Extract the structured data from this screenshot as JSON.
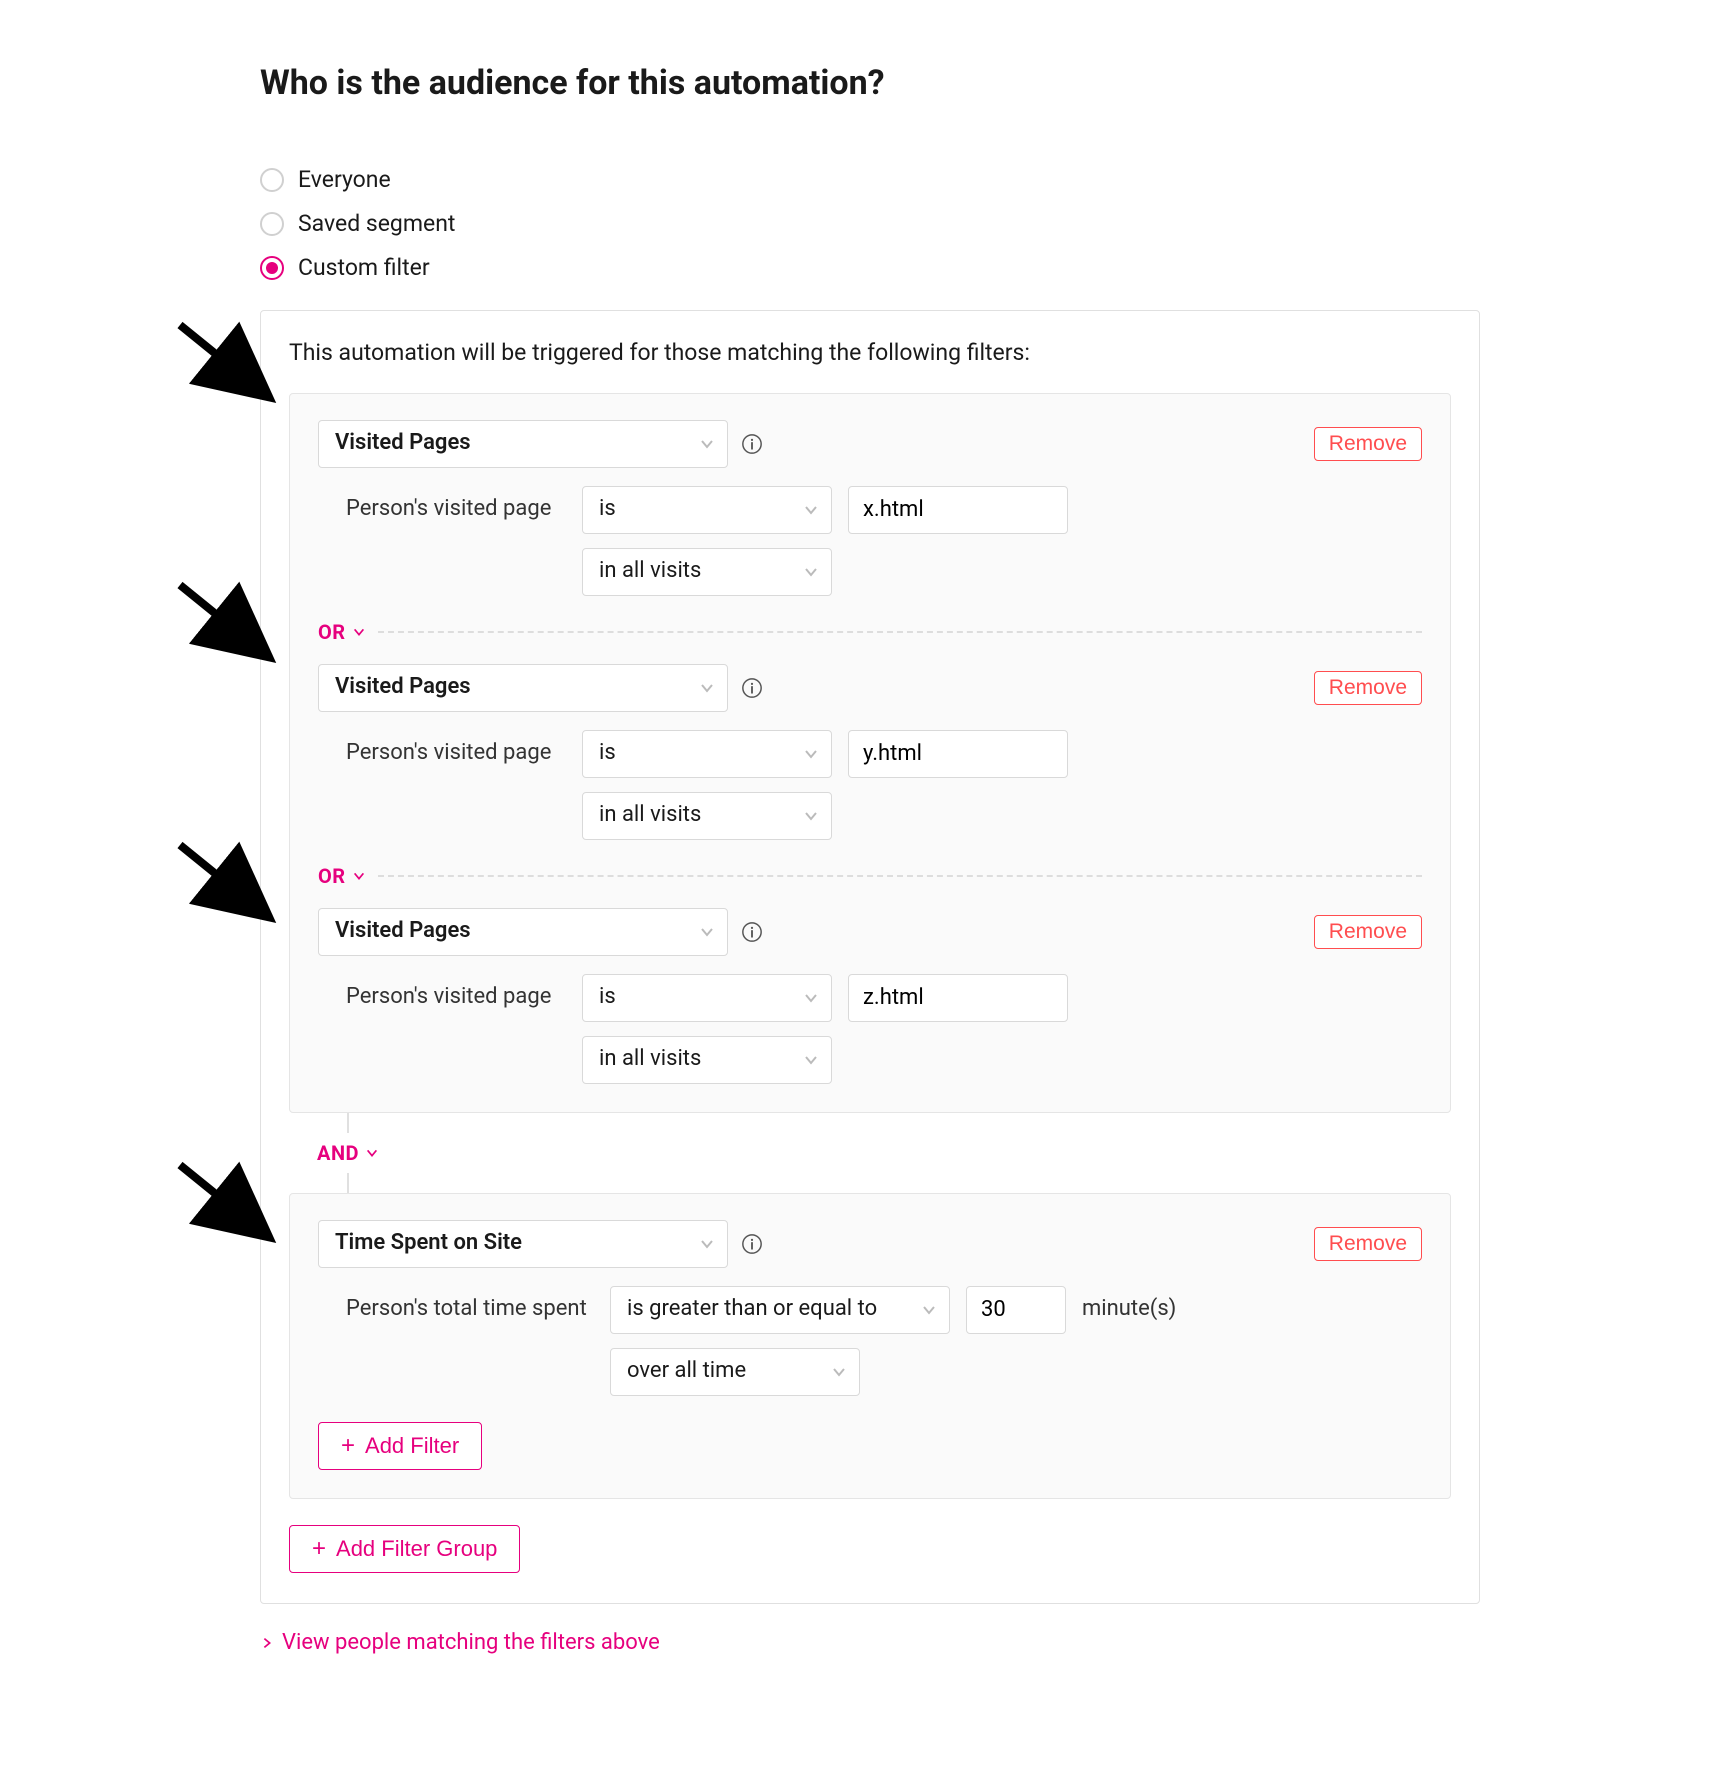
{
  "title": "Who is the audience for this automation?",
  "radios": {
    "everyone": "Everyone",
    "saved_segment": "Saved segment",
    "custom_filter": "Custom filter",
    "selected": "custom_filter"
  },
  "panel": {
    "intro": "This automation will be triggered for those matching the following filters:",
    "remove_label": "Remove",
    "or_label": "OR",
    "and_label": "AND",
    "add_filter_label": "Add Filter",
    "add_group_label": "Add Filter Group",
    "view_link": "View people matching the filters above"
  },
  "group1": {
    "filters": [
      {
        "type": "Visited Pages",
        "cond_label": "Person's visited page",
        "operator": "is",
        "value": "x.html",
        "scope": "in all visits"
      },
      {
        "type": "Visited Pages",
        "cond_label": "Person's visited page",
        "operator": "is",
        "value": "y.html",
        "scope": "in all visits"
      },
      {
        "type": "Visited Pages",
        "cond_label": "Person's visited page",
        "operator": "is",
        "value": "z.html",
        "scope": "in all visits"
      }
    ]
  },
  "group2": {
    "filter": {
      "type": "Time Spent on Site",
      "cond_label": "Person's total time spent",
      "operator": "is greater than or equal to",
      "value": "30",
      "unit": "minute(s)",
      "scope": "over all time"
    }
  }
}
